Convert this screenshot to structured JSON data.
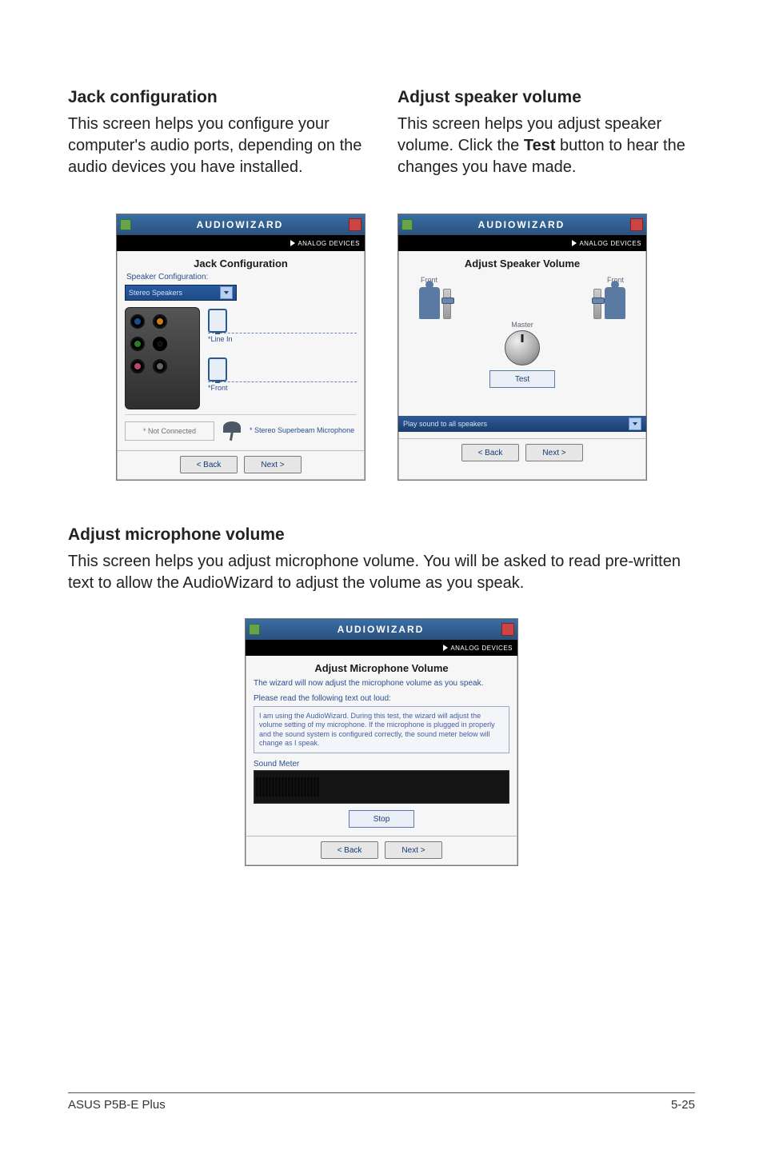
{
  "left": {
    "title": "Jack configuration",
    "body": "This screen helps you configure your computer's audio ports, depending on the audio devices you have installed."
  },
  "right": {
    "title": "Adjust speaker volume",
    "body_pre": "This screen helps you adjust speaker volume. Click the ",
    "body_bold": "Test",
    "body_post": " button to hear the changes you have made."
  },
  "mic_section": {
    "title": "Adjust microphone volume",
    "body": "This screen helps you adjust microphone volume. You will be asked to read pre-written text to allow the AudioWizard to adjust the volume as you speak."
  },
  "common": {
    "app_title": "AUDIOWIZARD",
    "logo_text": "ANALOG DEVICES",
    "back_btn": "< Back",
    "next_btn": "Next >"
  },
  "jack_wiz": {
    "heading": "Jack Configuration",
    "subline": "Speaker Configuration:",
    "dropdown": "Stereo Speakers",
    "label_linein": "*Line In",
    "label_front": "*Front",
    "not_connected": "* Not Connected",
    "mic_label": "* Stereo Superbeam Microphone"
  },
  "speaker_wiz": {
    "heading": "Adjust Speaker Volume",
    "front_l": "Front",
    "front_r": "Front",
    "master": "Master",
    "test": "Test",
    "playbar": "Play sound to all speakers"
  },
  "mic_wiz": {
    "heading": "Adjust Microphone Volume",
    "desc": "The wizard will now adjust the microphone volume as you speak.",
    "sub": "Please read the following text out loud:",
    "textbox": "I am using the AudioWizard. During this test, the wizard will adjust the volume setting of my microphone. If the microphone is plugged in properly and the sound system is configured correctly, the sound meter below will change as I speak.",
    "meter_label": "Sound Meter",
    "stop": "Stop"
  },
  "footer": {
    "left": "ASUS P5B-E Plus",
    "right": "5-25"
  }
}
